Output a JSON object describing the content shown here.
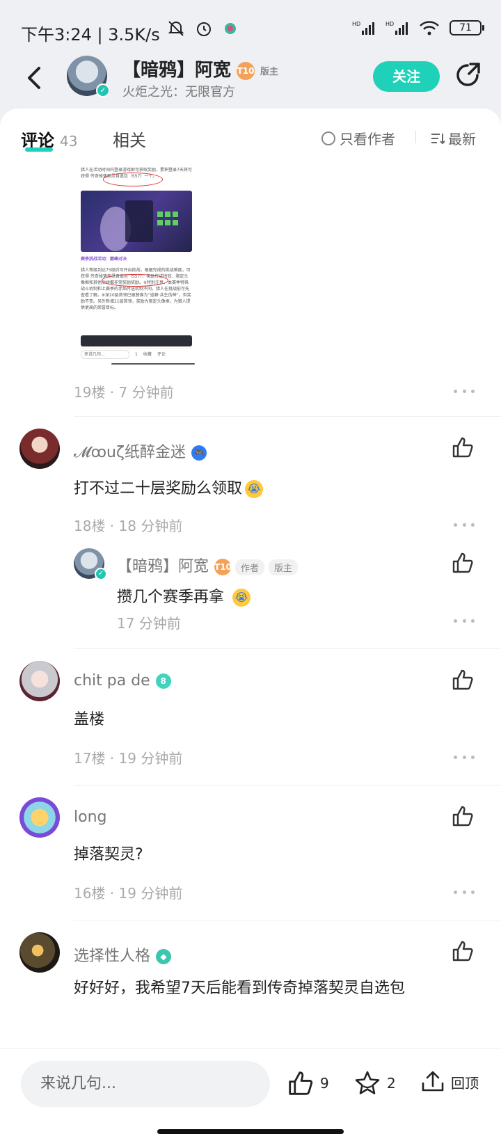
{
  "status": {
    "time": "下午3:24 | 3.5K/s",
    "battery": "71"
  },
  "header": {
    "name": "【暗鸦】阿宽",
    "level": "T10",
    "role": "版主",
    "subtitle": "火炬之光：无限官方",
    "follow_label": "关注"
  },
  "tabs": {
    "comments_label": "评论",
    "comments_count": "43",
    "related_label": "相关",
    "only_author_label": "只看作者",
    "sort_label": "最新"
  },
  "thumbnail": {
    "para1": "猎人在活动时间内登录游戏即可获取奖励，累积登录7天将可获得 传奇掉落契灵自选包（S57）一个。",
    "section_title": "赛季挑战活动：巅峰对决",
    "para2": "猎人等级到达75级后可开启挑战，根据完成的挑战难度，可获得 传奇掉落契灵自选包（S57）、奖励传送特效、限定头像框和其他后续都非常奖励奖励。※特别注意，本赛季特殊战斗机制和上赛季的赤焰传送机制不同，猎人在挑战前可先查看了解。※深20层首领已被替换为“巡峰·共生伪神”，但奖励不变。另外新增21层首领，奖励为限定头像框，为猎人提供更高的荣誉目标。",
    "bar_input": "来说几句...",
    "bar_like": "1",
    "bar_fav": "收藏",
    "bar_comment": "评论"
  },
  "floors": [
    {
      "floor": "19楼",
      "time": "7 分钟前"
    },
    {
      "user": "𝓜ꝏuζ纸醉金迷",
      "badge_color": "#2f7bf5",
      "text": "打不过二十层奖励么领取",
      "floor": "18楼",
      "time": "18 分钟前",
      "reply": {
        "user": "【暗鸦】阿宽",
        "level": "T10",
        "chip1": "作者",
        "chip2": "版主",
        "text": "攒几个赛季再拿",
        "time": "17 分钟前"
      }
    },
    {
      "user": "chit pa de",
      "badge_text": "8",
      "badge_color": "#40d3c0",
      "text": "盖楼",
      "floor": "17楼",
      "time": "19 分钟前"
    },
    {
      "user": "long",
      "text": "掉落契灵?",
      "floor": "16楼",
      "time": "19 分钟前"
    },
    {
      "user": "选择性人格",
      "badge_color": "#3cc6b0",
      "text": "好好好，我希望7天后能看到传奇掉落契灵自选包"
    }
  ],
  "bottom": {
    "input_placeholder": "来说几句...",
    "like_count": "9",
    "fav_count": "2",
    "top_label": "回顶"
  }
}
